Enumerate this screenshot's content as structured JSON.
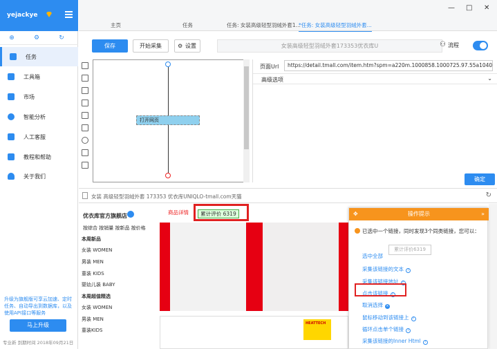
{
  "sidebar": {
    "username": "yejackye",
    "nav": [
      {
        "label": "任务"
      },
      {
        "label": "工具箱"
      },
      {
        "label": "市场"
      },
      {
        "label": "智能分析"
      },
      {
        "label": "人工客服"
      },
      {
        "label": "教程和帮助"
      },
      {
        "label": "关于我们"
      }
    ],
    "promo": "升级为旗舰版可享云加速、定时任务、自动导出到数据库，以及使用API接口等服务",
    "upgrade_label": "马上升级",
    "footer": "专业新 到期时间 2018年09月21日"
  },
  "tabs": [
    {
      "label": "主页"
    },
    {
      "label": "任务"
    },
    {
      "label": "任务: 女装高级轻型羽绒外套1..."
    },
    {
      "label": "*任务: 女装高级轻型羽绒外套..."
    }
  ],
  "window": {
    "minimize": "—",
    "maximize": "□",
    "close": "✕"
  },
  "toolbar": {
    "save": "保存",
    "start": "开始采集",
    "settings": "设置",
    "task_name": "女装高级轻型羽绒外套173353优衣库U",
    "flow": "流程"
  },
  "canvas": {
    "node_label": "打开网页"
  },
  "props": {
    "url_label": "页面Url",
    "url_value": "https://detail.tmall.com/item.htm?spm=a220m.1000858.1000725.97.55a1040a1",
    "advanced": "高级选项",
    "ok": "确定"
  },
  "browser": {
    "address": "女装 高级轻型羽绒外套 173353 优衣库UNIQLO-tmall.com天猫",
    "store_name": "优衣库官方旗舰店",
    "search_links": "按综合 按销量 按新品 按价格",
    "categories": [
      {
        "label": "本周新品",
        "header": true
      },
      {
        "label": "女装 WOMEN"
      },
      {
        "label": "男装 MEN"
      },
      {
        "label": "童装 KIDS"
      },
      {
        "label": "婴幼儿装 BABY"
      },
      {
        "label": "本周超值精选",
        "header": true
      },
      {
        "label": "女装 WOMEN"
      },
      {
        "label": "男装 MEN"
      },
      {
        "label": "童装KIDS"
      }
    ],
    "detail_tab": "商品详情",
    "review_tab": "累计评价 6319",
    "heattech": "HEATTECH"
  },
  "popup": {
    "title": "操作提示",
    "message": "已选中一个链接，同时发现3个同类链接，您可以：",
    "tooltip": "累计评价6319",
    "actions": [
      {
        "label": "选中全部"
      },
      {
        "label": "采集该链接的文本"
      },
      {
        "label": "采集该链接地址"
      },
      {
        "label": "点击该链接"
      },
      {
        "label": "取消选择"
      },
      {
        "label": "鼠标移动到该链接上"
      },
      {
        "label": "循环点击单个链接"
      },
      {
        "label": "采集该链接的Inner Html"
      }
    ]
  },
  "colors": {
    "accent": "#2d8cf0",
    "popup_header": "#f7941d",
    "highlight": "#e02020"
  }
}
